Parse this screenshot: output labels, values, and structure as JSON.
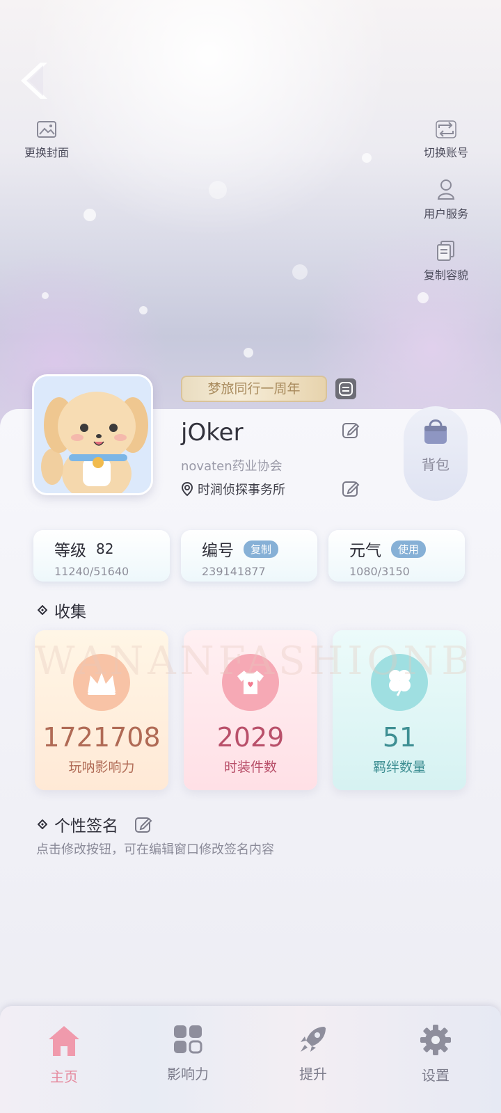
{
  "cover": {
    "change_cover_label": "更换封面",
    "switch_account_label": "切换账号",
    "user_service_label": "用户服务",
    "copy_look_label": "复制容貌"
  },
  "profile": {
    "anniversary_badge": "梦旅同行一周年",
    "username": "jOker",
    "guild": "novaten药业协会",
    "agency": "时涧侦探事务所",
    "bag_label": "背包"
  },
  "stats": [
    {
      "title": "等级",
      "value": "82",
      "sub": "11240/51640"
    },
    {
      "title": "编号",
      "pill": "复制",
      "sub": "239141877"
    },
    {
      "title": "元气",
      "pill": "使用",
      "sub": "1080/3150"
    }
  ],
  "collection": {
    "heading": "收集",
    "watermark": "WANANFASHIONBOND",
    "cards": [
      {
        "value": "1721708",
        "label": "玩呐影响力",
        "icon": "crown-icon",
        "accent": "#b06a55"
      },
      {
        "value": "2029",
        "label": "时装件数",
        "icon": "tshirt-icon",
        "accent": "#b9506a"
      },
      {
        "value": "51",
        "label": "羁绊数量",
        "icon": "clover-icon",
        "accent": "#3e8f93"
      }
    ]
  },
  "signature": {
    "heading": "个性签名",
    "hint": "点击修改按钮，可在编辑窗口修改签名内容"
  },
  "nav": {
    "items": [
      {
        "label": "主页",
        "icon": "home-icon",
        "active": true
      },
      {
        "label": "影响力",
        "icon": "grid-icon"
      },
      {
        "label": "提升",
        "icon": "rocket-icon"
      },
      {
        "label": "设置",
        "icon": "gear-icon"
      }
    ]
  },
  "colors": {
    "accent_pink": "#e58a9e",
    "pill_blue": "#86b0d6",
    "gold": "#d9c39a"
  }
}
